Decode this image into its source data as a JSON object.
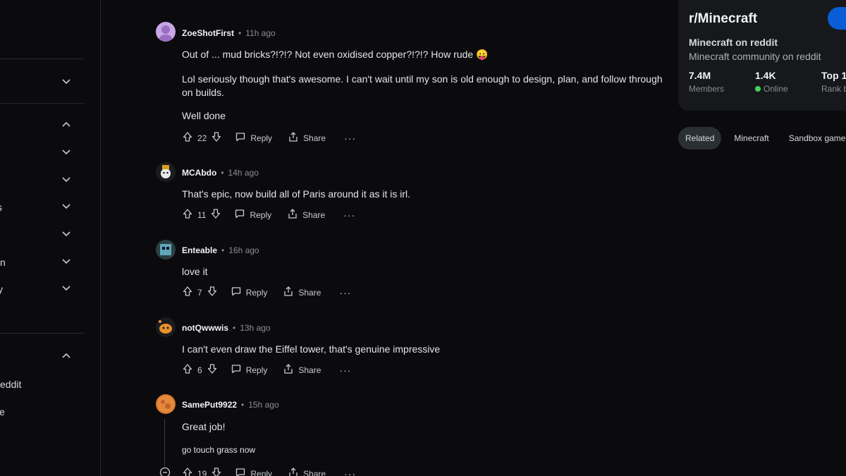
{
  "sidebar": {
    "fragments": [
      "s",
      "n",
      "y",
      "eddit",
      "e"
    ]
  },
  "comments": [
    {
      "author": "ZoeShotFirst",
      "time": "11h ago",
      "paragraphs": [
        "Out of ... mud bricks?!?!? Not even oxidised copper?!?!? How rude 😛",
        "Lol seriously though that's awesome. I can't wait until my son is old enough to design, plan, and follow through on builds.",
        "Well done"
      ],
      "votes": "22"
    },
    {
      "author": "MCAbdo",
      "time": "14h ago",
      "paragraphs": [
        "That's epic, now build all of Paris around it as it is irl."
      ],
      "votes": "11"
    },
    {
      "author": "Enteable",
      "time": "16h ago",
      "paragraphs": [
        "love it"
      ],
      "votes": "7"
    },
    {
      "author": "notQwwwis",
      "time": "13h ago",
      "paragraphs": [
        "I can't even draw the Eiffel tower, that's genuine impressive"
      ],
      "votes": "6"
    },
    {
      "author": "SamePut9922",
      "time": "15h ago",
      "paragraphs": [
        "Great job!",
        "go touch grass now"
      ],
      "votes": "19"
    }
  ],
  "labels": {
    "reply": "Reply",
    "share": "Share",
    "more": "···",
    "separator": "•"
  },
  "community": {
    "name": "r/Minecraft",
    "title": "Minecraft on reddit",
    "description": "Minecraft community on reddit",
    "stats": [
      {
        "value": "7.4M",
        "label": "Members"
      },
      {
        "value": "1.4K",
        "label": "Online"
      },
      {
        "value": "Top 1",
        "label": "Rank b"
      }
    ]
  },
  "chips": [
    "Related",
    "Minecraft",
    "Sandbox game"
  ],
  "colors": {
    "background": "#0b0b0e",
    "card": "#16181b",
    "join_button": "#0a5dd6",
    "online": "#46d160"
  }
}
